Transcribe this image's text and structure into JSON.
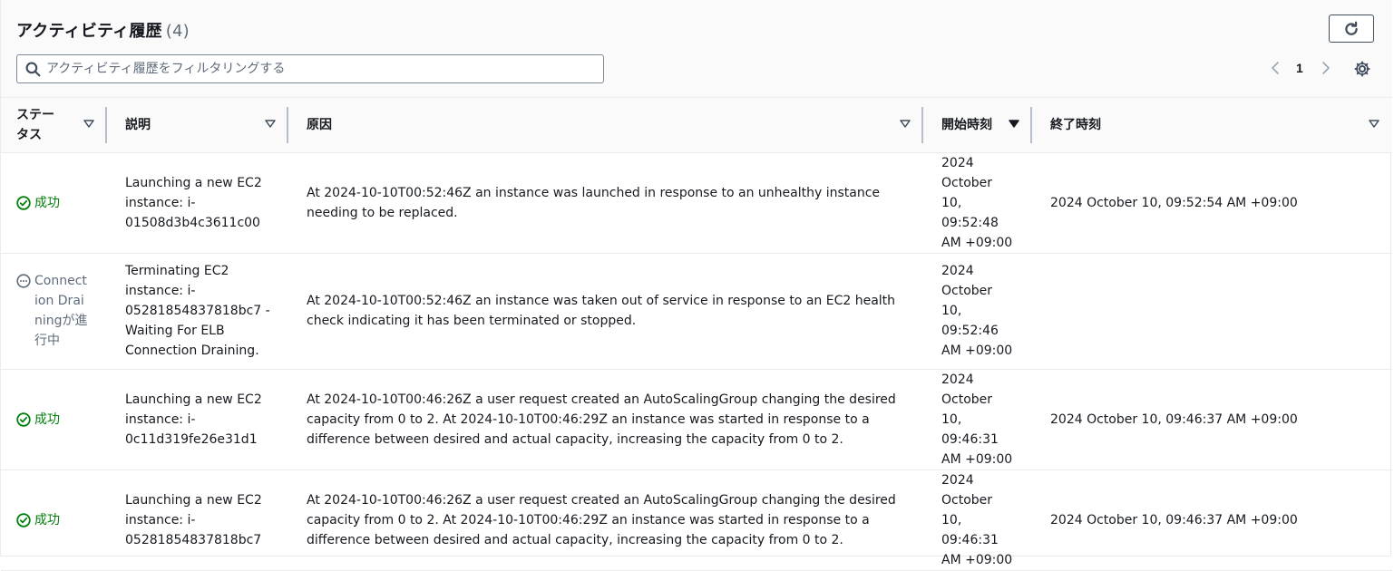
{
  "header": {
    "title": "アクティビティ履歴",
    "count": "(4)",
    "refresh_icon": "refresh-icon"
  },
  "search": {
    "placeholder": "アクティビティ履歴をフィルタリングする",
    "value": ""
  },
  "pagination": {
    "current_page": "1",
    "prev_icon": "chevron-left-icon",
    "next_icon": "chevron-right-icon",
    "settings_icon": "gear-icon"
  },
  "table": {
    "columns": [
      {
        "label": "ステータス",
        "sort_icon": "sort-caret-outline-icon"
      },
      {
        "label": "説明",
        "sort_icon": "sort-caret-outline-icon"
      },
      {
        "label": "原因",
        "sort_icon": "sort-caret-outline-icon"
      },
      {
        "label": "開始時刻",
        "sort_icon": "sort-caret-filled-icon"
      },
      {
        "label": "終了時刻",
        "sort_icon": "sort-caret-outline-icon"
      }
    ],
    "rows": [
      {
        "status": "成功",
        "status_type": "success",
        "description": "Launching a new EC2 instance: i-01508d3b4c3611c00",
        "cause": "At 2024-10-10T00:52:46Z an instance was launched in response to an unhealthy instance needing to be replaced.",
        "start": "2024 October 10, 09:52:48 AM +09:00",
        "end": "2024 October 10, 09:52:54 AM +09:00"
      },
      {
        "status": "Connection Drainingが進行中",
        "status_type": "in-progress",
        "description": "Terminating EC2 instance: i-05281854837818bc7 - Waiting For ELB Connection Draining.",
        "cause": "At 2024-10-10T00:52:46Z an instance was taken out of service in response to an EC2 health check indicating it has been terminated or stopped.",
        "start": "2024 October 10, 09:52:46 AM +09:00",
        "end": ""
      },
      {
        "status": "成功",
        "status_type": "success",
        "description": "Launching a new EC2 instance: i-0c11d319fe26e31d1",
        "cause": "At 2024-10-10T00:46:26Z a user request created an AutoScalingGroup changing the desired capacity from 0 to 2. At 2024-10-10T00:46:29Z an instance was started in response to a difference between desired and actual capacity, increasing the capacity from 0 to 2.",
        "start": "2024 October 10, 09:46:31 AM +09:00",
        "end": "2024 October 10, 09:46:37 AM +09:00"
      },
      {
        "status": "成功",
        "status_type": "success",
        "description": "Launching a new EC2 instance: i-05281854837818bc7",
        "cause": "At 2024-10-10T00:46:26Z a user request created an AutoScalingGroup changing the desired capacity from 0 to 2. At 2024-10-10T00:46:29Z an instance was started in response to a difference between desired and actual capacity, increasing the capacity from 0 to 2.",
        "start": "2024 October 10, 09:46:31 AM +09:00",
        "end": "2024 October 10, 09:46:37 AM +09:00"
      }
    ]
  },
  "colors": {
    "success": "#037f0c",
    "in_progress": "#5f6b7a",
    "header_bg": "#fafafa",
    "border": "#e9ebed",
    "text": "#16191f"
  }
}
